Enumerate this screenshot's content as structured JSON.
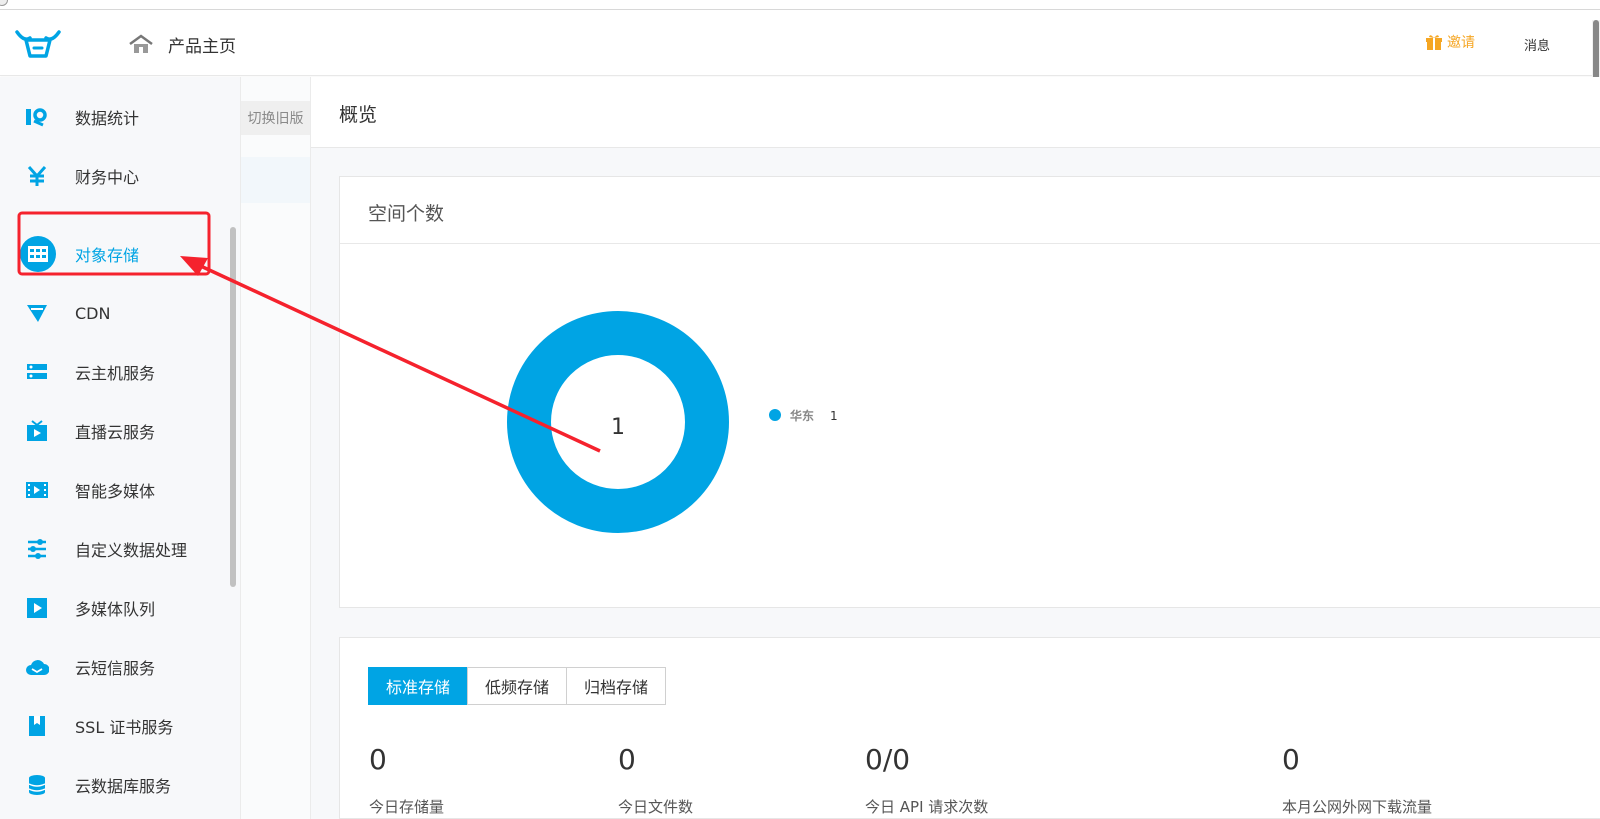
{
  "topbar": {
    "home_label": "产品主页",
    "invite_label": "邀请",
    "message_label": "消息"
  },
  "sidebar": {
    "items": [
      {
        "label": "数据统计",
        "icon": "stats-icon"
      },
      {
        "label": "财务中心",
        "icon": "yen-icon"
      },
      {
        "label": "对象存储",
        "icon": "storage-icon",
        "active": true
      },
      {
        "label": "CDN",
        "icon": "cdn-icon"
      },
      {
        "label": "云主机服务",
        "icon": "server-icon"
      },
      {
        "label": "直播云服务",
        "icon": "tv-icon"
      },
      {
        "label": "智能多媒体",
        "icon": "film-icon"
      },
      {
        "label": "自定义数据处理",
        "icon": "sliders-icon"
      },
      {
        "label": "多媒体队列",
        "icon": "play-icon"
      },
      {
        "label": "云短信服务",
        "icon": "cloud-message-icon"
      },
      {
        "label": "SSL 证书服务",
        "icon": "bookmark-icon"
      },
      {
        "label": "云数据库服务",
        "icon": "database-icon"
      }
    ]
  },
  "subpanel": {
    "switch_label": "切换旧版"
  },
  "main": {
    "title": "概览",
    "space_card_title": "空间个数",
    "tabs": [
      {
        "label": "标准存储",
        "active": true
      },
      {
        "label": "低频存储",
        "active": false
      },
      {
        "label": "归档存储",
        "active": false
      }
    ],
    "stats": [
      "0",
      "0",
      "0/0",
      "0"
    ],
    "stat_labels": [
      "今日存储量",
      "今日文件数",
      "今日 API 请求次数",
      "本月公网外网下载流量"
    ]
  },
  "chart_data": {
    "type": "pie",
    "variant": "donut",
    "center_label": "1",
    "categories": [
      "华东"
    ],
    "values": [
      1
    ],
    "colors": [
      "#00a4e4"
    ],
    "legend": "right"
  },
  "annotation": {
    "color": "#f5222d"
  }
}
